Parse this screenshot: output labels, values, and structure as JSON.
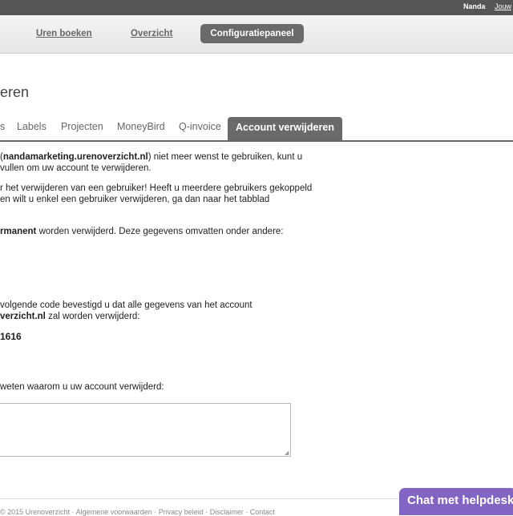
{
  "topbar": {
    "user": "Nanda",
    "link": "Jouw"
  },
  "nav": {
    "items": [
      {
        "label": "Uren boeken"
      },
      {
        "label": "Overzicht"
      }
    ],
    "active": "Configuratiepaneel"
  },
  "heading": "eren",
  "tabs": [
    {
      "label": "s"
    },
    {
      "label": "Labels"
    },
    {
      "label": "Projecten"
    },
    {
      "label": "MoneyBird"
    },
    {
      "label": "Q-invoice"
    }
  ],
  "active_tab": "Account verwijderen",
  "content": {
    "p1_pre": "(",
    "p1_bold": "nandamarketing.urenoverzicht.nl",
    "p1_post": ") niet meer wenst te gebruiken, kunt u",
    "p1_line2": "vullen om uw account te verwijderen.",
    "p2_line1": "r het verwijderen van een gebruiker! Heeft u meerdere gebruikers gekoppeld",
    "p2_line2": "en wilt u enkel een gebruiker verwijderen, ga dan naar het tabblad",
    "p3_bold": "rmanent",
    "p3_post": " worden verwijderd. Deze gegevens omvatten onder andere:",
    "p4_line1": "volgende code bevestigd u dat alle gegevens van het account",
    "p4_bold": "verzicht.nl",
    "p4_post": " zal worden verwijderd:",
    "code": "1616",
    "reason_label": "weten waarom u uw account verwijderd:"
  },
  "footer": "© 2015 Urenoverzicht · Algemene voorwaarden · Privacy beleid · Disclaimer · Contact",
  "chat": {
    "label": "Chat met helpdesk"
  },
  "colors": {
    "accent": "#6a6a6a",
    "chat": "#8265c2",
    "topbar": "#555555"
  }
}
